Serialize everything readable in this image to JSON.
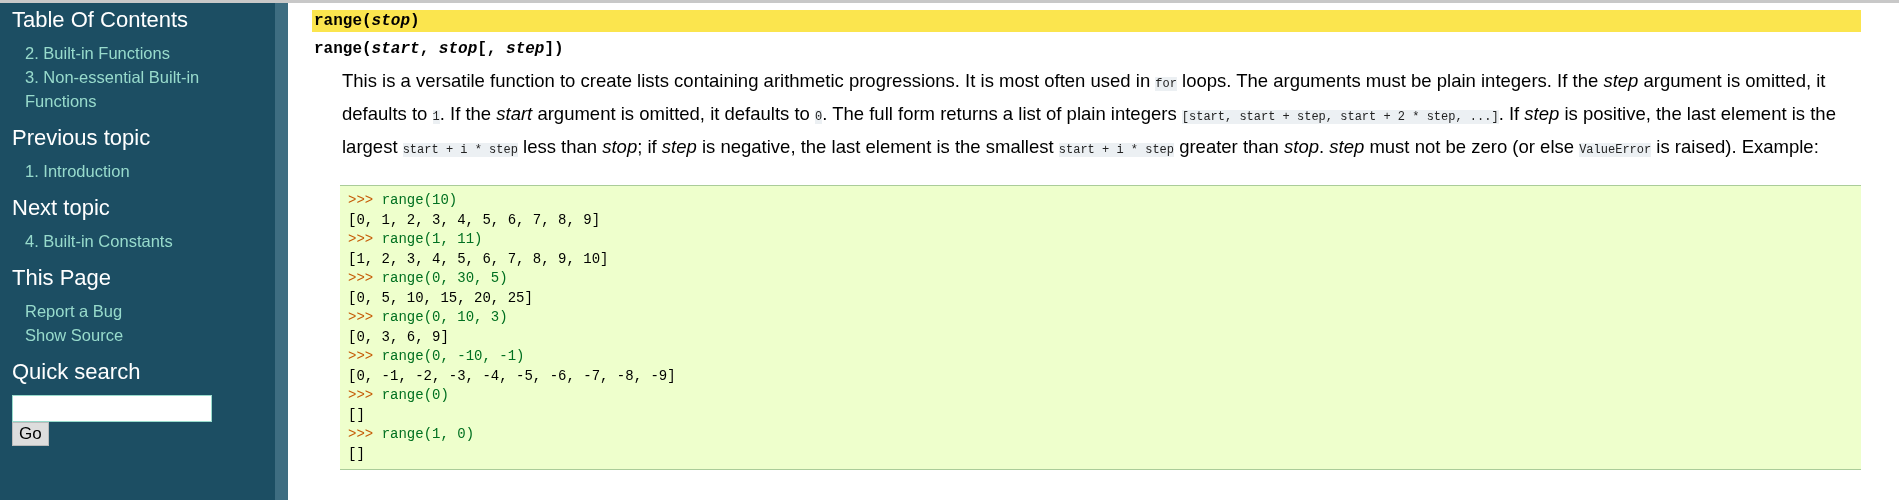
{
  "sidebar": {
    "sections": [
      {
        "heading": "Table Of Contents",
        "links": [
          "2. Built-in Functions",
          "3. Non-essential Built-in Functions"
        ]
      },
      {
        "heading": "Previous topic",
        "links": [
          "1. Introduction"
        ]
      },
      {
        "heading": "Next topic",
        "links": [
          "4. Built-in Constants"
        ]
      },
      {
        "heading": "This Page",
        "links": [
          "Report a Bug",
          "Show Source"
        ]
      },
      {
        "heading": "Quick search"
      }
    ],
    "search": {
      "button": "Go"
    }
  },
  "signatures": [
    {
      "text": "range(*stop*)",
      "selected": true
    },
    {
      "text": "range(*start*, *stop*[, *step*])",
      "selected": false
    }
  ],
  "description": [
    {
      "kind": "text",
      "text": "This is a versatile function to create lists containing arithmetic progressions. It is most often used in "
    },
    {
      "kind": "code",
      "text": "for"
    },
    {
      "kind": "text",
      "text": " loops. The arguments must be plain integers. If the *step* argument is omitted, it defaults to "
    },
    {
      "kind": "code",
      "text": "1"
    },
    {
      "kind": "text",
      "text": ". If the *start* argument is omitted, it defaults to "
    },
    {
      "kind": "code",
      "text": "0"
    },
    {
      "kind": "text",
      "text": ". The full form returns a list of plain integers "
    },
    {
      "kind": "code",
      "text": "[start, start + step, start + 2 * step, ...]"
    },
    {
      "kind": "text",
      "text": ". If *step* is positive, the last element is the largest "
    },
    {
      "kind": "code",
      "text": "start + i * step"
    },
    {
      "kind": "text",
      "text": " less than *stop*; if *step* is negative, the last element is the smallest "
    },
    {
      "kind": "code",
      "text": "start + i * step"
    },
    {
      "kind": "text",
      "text": " greater than *stop*. *step* must not be zero (or else "
    },
    {
      "kind": "code",
      "text": "ValueError"
    },
    {
      "kind": "text",
      "text": " is raised). Example:"
    }
  ],
  "example": [
    {
      "kind": "input",
      "prompt": ">>>",
      "text": "range(10)"
    },
    {
      "kind": "output",
      "text": "[0, 1, 2, 3, 4, 5, 6, 7, 8, 9]"
    },
    {
      "kind": "input",
      "prompt": ">>>",
      "text": "range(1, 11)"
    },
    {
      "kind": "output",
      "text": "[1, 2, 3, 4, 5, 6, 7, 8, 9, 10]"
    },
    {
      "kind": "input",
      "prompt": ">>>",
      "text": "range(0, 30, 5)"
    },
    {
      "kind": "output",
      "text": "[0, 5, 10, 15, 20, 25]"
    },
    {
      "kind": "input",
      "prompt": ">>>",
      "text": "range(0, 10, 3)"
    },
    {
      "kind": "output",
      "text": "[0, 3, 6, 9]"
    },
    {
      "kind": "input",
      "prompt": ">>>",
      "text": "range(0, -10, -1)"
    },
    {
      "kind": "output",
      "text": "[0, -1, -2, -3, -4, -5, -6, -7, -8, -9]"
    },
    {
      "kind": "input",
      "prompt": ">>>",
      "text": "range(0)"
    },
    {
      "kind": "output",
      "text": "[]"
    },
    {
      "kind": "input",
      "prompt": ">>>",
      "text": "range(1, 0)"
    },
    {
      "kind": "output",
      "text": "[]"
    }
  ]
}
